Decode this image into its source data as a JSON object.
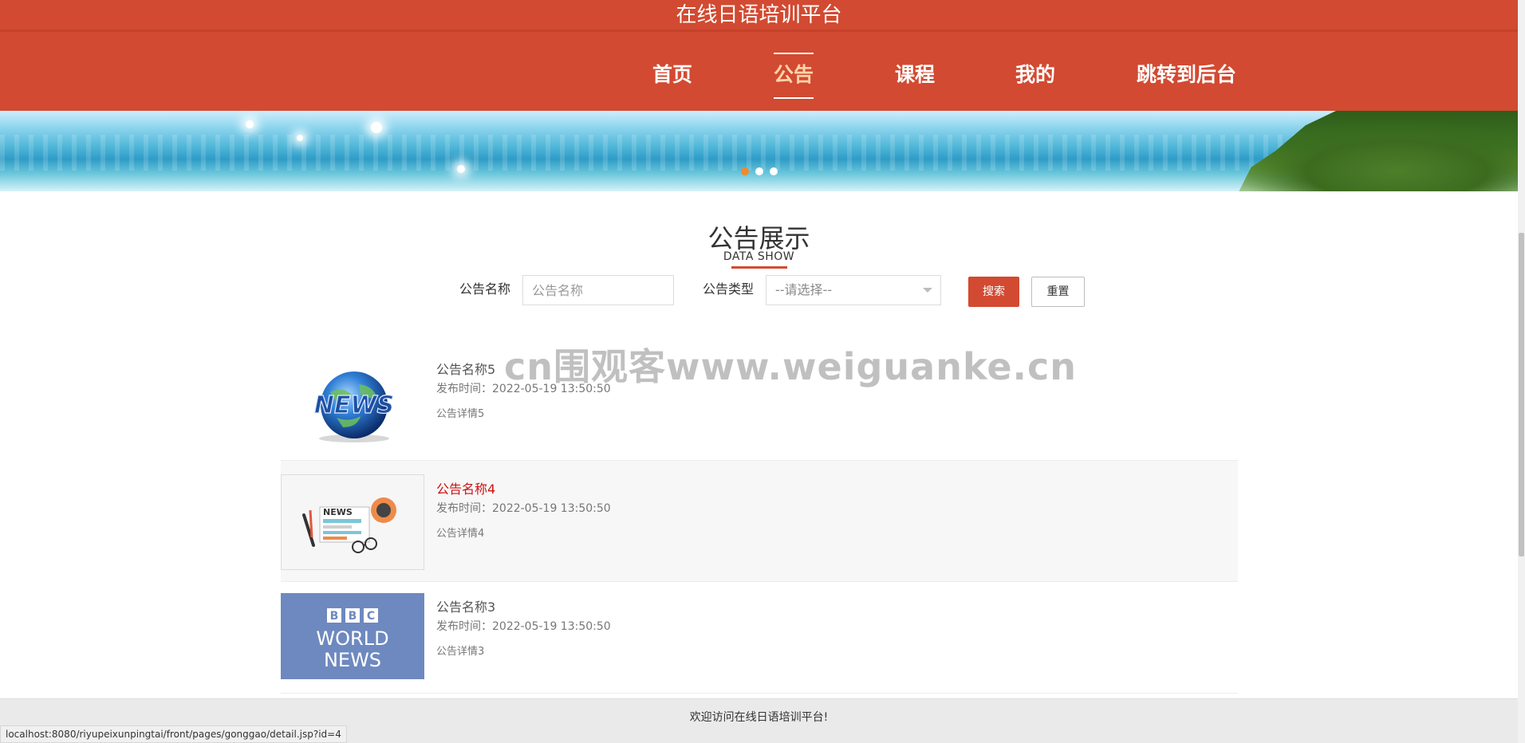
{
  "header": {
    "title": "在线日语培训平台",
    "nav": [
      {
        "label": "首页",
        "active": false
      },
      {
        "label": "公告",
        "active": true
      },
      {
        "label": "课程",
        "active": false
      },
      {
        "label": "我的",
        "active": false
      },
      {
        "label": "跳转到后台",
        "active": false
      }
    ],
    "accent_color": "#d24a31"
  },
  "banner": {
    "carousel_dots": 3,
    "active_dot": 1
  },
  "section": {
    "title": "公告展示",
    "subtitle": "DATA SHOW"
  },
  "search": {
    "name_label": "公告名称",
    "name_placeholder": "公告名称",
    "type_label": "公告类型",
    "type_selected": "--请选择--",
    "search_button": "搜索",
    "reset_button": "重置"
  },
  "notices": [
    {
      "title": "公告名称5",
      "date_label": "发布时间：",
      "date": "2022-05-19 13:50:50",
      "detail": "公告详情5",
      "image": "news-globe-image",
      "highlighted": false
    },
    {
      "title": "公告名称4",
      "date_label": "发布时间：",
      "date": "2022-05-19 13:50:50",
      "detail": "公告详情4",
      "image": "newspaper-illustration-image",
      "highlighted": true
    },
    {
      "title": "公告名称3",
      "date_label": "发布时间：",
      "date": "2022-05-19 13:50:50",
      "detail": "公告详情3",
      "image": "bbc-world-news-image",
      "highlighted": false
    }
  ],
  "bbc_logo": {
    "line1": "BBC",
    "line2": "WORLD",
    "line3": "NEWS"
  },
  "news_logo_text": "NEWS",
  "watermark": "cn围观客www.weiguanke.cn",
  "footer": {
    "text": "欢迎访问在线日语培训平台!"
  },
  "status_bar": {
    "url": "localhost:8080/riyupeixunpingtai/front/pages/gonggao/detail.jsp?id=4"
  }
}
